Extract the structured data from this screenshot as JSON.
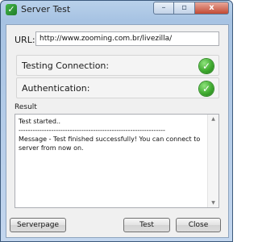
{
  "window": {
    "title": "Server Test",
    "buttons": {
      "minimize": "–",
      "maximize": "▫",
      "close": "x"
    }
  },
  "form": {
    "url_label": "URL:",
    "url_value": "http://www.zooming.com.br/livezilla/"
  },
  "status": [
    {
      "label": "Testing Connection:",
      "state": "success"
    },
    {
      "label": "Authentication:",
      "state": "success"
    }
  ],
  "result": {
    "label": "Result",
    "text": "Test started..\n---------------------------------------------------------------\nMessage - Test finished successfully! You can connect to server from now on."
  },
  "footer": {
    "serverpage_label": "Serverpage",
    "test_label": "Test",
    "close_label": "Close"
  },
  "colors": {
    "success": "#3faa2f",
    "title_bar": "#b9d1ea"
  }
}
